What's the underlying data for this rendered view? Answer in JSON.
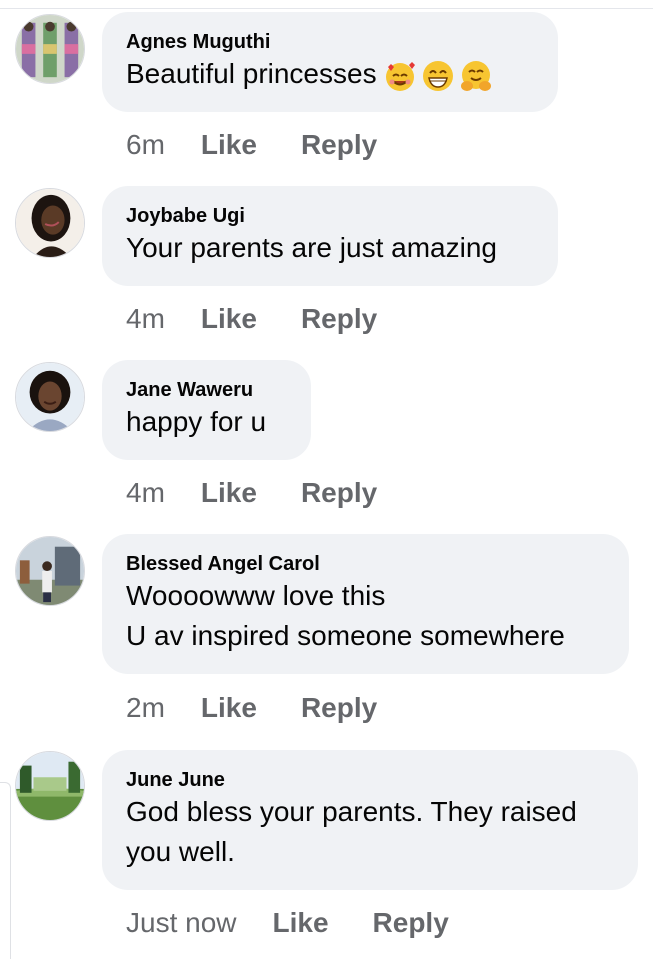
{
  "comments": [
    {
      "author": "Agnes Muguthi",
      "text": "Beautiful princesses",
      "emojis": [
        "smiling-face-with-hearts",
        "grinning-face-with-smiling-eyes",
        "hugging-face"
      ],
      "time": "6m",
      "like": "Like",
      "reply": "Reply"
    },
    {
      "author": "Joybabe Ugi",
      "text": "Your parents are just amazing",
      "time": "4m",
      "like": "Like",
      "reply": "Reply"
    },
    {
      "author": "Jane Waweru",
      "text": "happy for u",
      "time": "4m",
      "like": "Like",
      "reply": "Reply"
    },
    {
      "author": "Blessed Angel Carol",
      "text": "Woooowww love this\nU av inspired someone somewhere",
      "time": "2m",
      "like": "Like",
      "reply": "Reply"
    },
    {
      "author": "June June",
      "text": "God bless your parents. They raised\nyou well.",
      "time": "Just now",
      "like": "Like",
      "reply": "Reply"
    }
  ],
  "colors": {
    "bubble_bg": "#f0f2f5",
    "text": "#050505",
    "meta": "#65676b"
  }
}
